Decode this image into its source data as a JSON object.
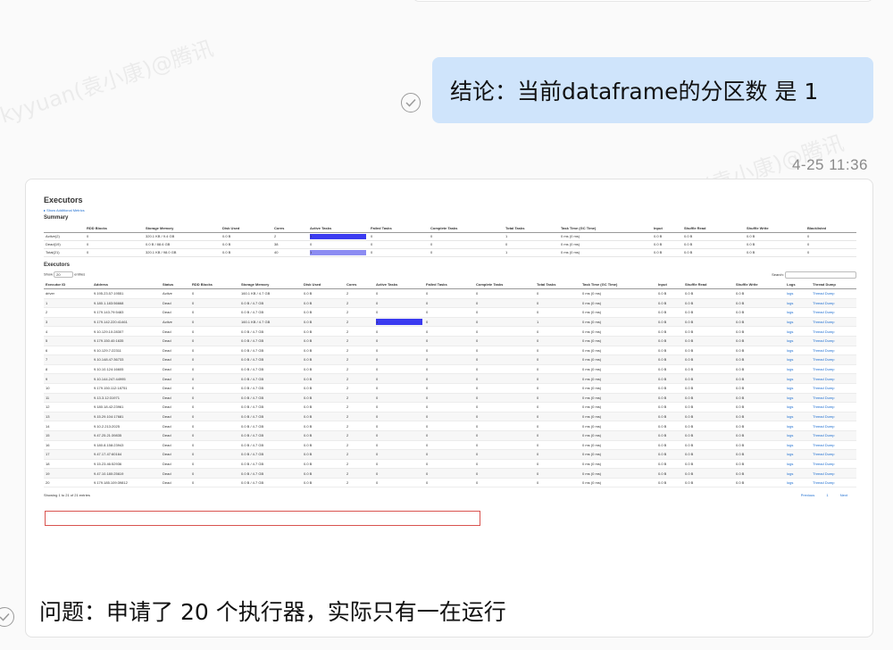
{
  "chat": {
    "watermark_text": "kyyuan(袁小康)@腾讯",
    "message_1": "结论：当前dataframe的分区数 是 1",
    "timestamp": "4-25 11:36",
    "message_2": "问题：申请了 20 个执行器，实际只有一在运行"
  },
  "screenshot": {
    "title": "Executors",
    "show_metrics": "▸ Show Additional Metrics",
    "summary": {
      "title": "Summary",
      "columns": [
        "",
        "RDD Blocks",
        "Storage Memory",
        "Disk Used",
        "Cores",
        "Active Tasks",
        "Failed Tasks",
        "Complete Tasks",
        "Total Tasks",
        "Task Time (GC Time)",
        "Input",
        "Shuffle Read",
        "Shuffle Write",
        "Blacklisted"
      ],
      "rows": [
        {
          "label": "Active(2)",
          "rdd": "0",
          "storage": "320.1 KB / 9.4 GB",
          "disk": "0.0 B",
          "cores": "2",
          "active": "1",
          "active_fill": 1.0,
          "failed": "0",
          "complete": "0",
          "total": "1",
          "time": "0 ms (0 ms)",
          "input": "0.0 B",
          "shuffle_read": "0.0 B",
          "shuffle_write": "0.0 B",
          "blacklisted": "0"
        },
        {
          "label": "Dead(19)",
          "rdd": "0",
          "storage": "0.0 B / 88.6 GB",
          "disk": "0.0 B",
          "cores": "38",
          "active": "0",
          "active_fill": 0.0,
          "failed": "0",
          "complete": "0",
          "total": "0",
          "time": "0 ms (0 ms)",
          "input": "0.0 B",
          "shuffle_read": "0.0 B",
          "shuffle_write": "0.0 B",
          "blacklisted": "0"
        },
        {
          "label": "Total(21)",
          "rdd": "0",
          "storage": "320.1 KB / 98.0 GB",
          "disk": "0.0 B",
          "cores": "40",
          "active": "1",
          "active_fill": 1.0,
          "failed": "0",
          "complete": "0",
          "total": "1",
          "time": "0 ms (0 ms)",
          "input": "0.0 B",
          "shuffle_read": "0.0 B",
          "shuffle_write": "0.0 B",
          "blacklisted": "0"
        }
      ],
      "active_color": "#3b3bf0",
      "total_color": "#8c8cf2"
    },
    "executors": {
      "title": "Executors",
      "show_label": "Show",
      "entries_value": "20",
      "entries_label": "entries",
      "search_label": "Search:",
      "columns": [
        "Executor ID",
        "Address",
        "Status",
        "RDD Blocks",
        "Storage Memory",
        "Disk Used",
        "Cores",
        "Active Tasks",
        "Failed Tasks",
        "Complete Tasks",
        "Total Tasks",
        "Task Time (GC Time)",
        "Input",
        "Shuffle Read",
        "Shuffle Write",
        "Logs",
        "Thread Dump"
      ],
      "rows": [
        {
          "id": "driver",
          "address": "9.195.23.57:19551",
          "status": "Active",
          "storage": "160.1 KB / 4.7 GB",
          "active": "0",
          "active_fill": 0.0,
          "total": "0"
        },
        {
          "id": "1",
          "address": "9.180.1.183:56668",
          "status": "Dead",
          "storage": "0.0 B / 4.7 GB",
          "active": "0",
          "active_fill": 0.0,
          "total": "0"
        },
        {
          "id": "2",
          "address": "9.179.143.79:5483",
          "status": "Dead",
          "storage": "0.0 B / 4.7 GB",
          "active": "0",
          "active_fill": 0.0,
          "total": "0"
        },
        {
          "id": "3",
          "address": "9.179.142.220:41461",
          "status": "Active",
          "storage": "160.1 KB / 4.7 GB",
          "active": "1",
          "active_fill": 1.0,
          "total": "1"
        },
        {
          "id": "4",
          "address": "9.10.129.10:28307",
          "status": "Dead",
          "storage": "0.0 B / 4.7 GB",
          "active": "0",
          "active_fill": 0.0,
          "total": "0"
        },
        {
          "id": "5",
          "address": "9.179.150.40:1635",
          "status": "Dead",
          "storage": "0.0 B / 4.7 GB",
          "active": "0",
          "active_fill": 0.0,
          "total": "0"
        },
        {
          "id": "6",
          "address": "9.10.129.7:22311",
          "status": "Dead",
          "storage": "0.0 B / 4.7 GB",
          "active": "0",
          "active_fill": 0.0,
          "total": "0"
        },
        {
          "id": "7",
          "address": "9.10.148.47:36733",
          "status": "Dead",
          "storage": "0.0 B / 4.7 GB",
          "active": "0",
          "active_fill": 0.0,
          "total": "0"
        },
        {
          "id": "8",
          "address": "9.10.10.124:16605",
          "status": "Dead",
          "storage": "0.0 B / 4.7 GB",
          "active": "0",
          "active_fill": 0.0,
          "total": "0"
        },
        {
          "id": "9",
          "address": "9.10.144.247:44995",
          "status": "Dead",
          "storage": "0.0 B / 4.7 GB",
          "active": "0",
          "active_fill": 0.0,
          "total": "0"
        },
        {
          "id": "10",
          "address": "9.179.150.112:18751",
          "status": "Dead",
          "storage": "0.0 B / 4.7 GB",
          "active": "0",
          "active_fill": 0.0,
          "total": "0"
        },
        {
          "id": "11",
          "address": "9.13.3.12:31971",
          "status": "Dead",
          "storage": "0.0 B / 4.7 GB",
          "active": "0",
          "active_fill": 0.0,
          "total": "0"
        },
        {
          "id": "12",
          "address": "9.180.18.42:23961",
          "status": "Dead",
          "storage": "0.0 B / 4.7 GB",
          "active": "0",
          "active_fill": 0.0,
          "total": "0"
        },
        {
          "id": "13",
          "address": "9.15.29.104:17681",
          "status": "Dead",
          "storage": "0.0 B / 4.7 GB",
          "active": "0",
          "active_fill": 0.0,
          "total": "0"
        },
        {
          "id": "14",
          "address": "9.10.2.213:2025",
          "status": "Dead",
          "storage": "0.0 B / 4.7 GB",
          "active": "0",
          "active_fill": 0.0,
          "total": "0"
        },
        {
          "id": "15",
          "address": "9.47.25.21:39835",
          "status": "Dead",
          "storage": "0.0 B / 4.7 GB",
          "active": "0",
          "active_fill": 0.0,
          "total": "0"
        },
        {
          "id": "16",
          "address": "9.180.8.158:23943",
          "status": "Dead",
          "storage": "0.0 B / 4.7 GB",
          "active": "0",
          "active_fill": 0.0,
          "total": "0"
        },
        {
          "id": "17",
          "address": "9.47.17.47:60164",
          "status": "Dead",
          "storage": "0.0 B / 4.7 GB",
          "active": "0",
          "active_fill": 0.0,
          "total": "0"
        },
        {
          "id": "18",
          "address": "9.15.23.46:52936",
          "status": "Dead",
          "storage": "0.0 B / 4.7 GB",
          "active": "0",
          "active_fill": 0.0,
          "total": "0"
        },
        {
          "id": "19",
          "address": "9.47.10.180:25619",
          "status": "Dead",
          "storage": "0.0 B / 4.7 GB",
          "active": "0",
          "active_fill": 0.0,
          "total": "0"
        },
        {
          "id": "20",
          "address": "9.179.185.109:39812",
          "status": "Dead",
          "storage": "0.0 B / 4.7 GB",
          "active": "0",
          "active_fill": 0.0,
          "total": "0"
        }
      ],
      "cell_defaults": {
        "rdd": "0",
        "disk": "0.0 B",
        "cores": "2",
        "failed": "0",
        "complete": "0",
        "time": "0 ms (0 ms)",
        "input": "0.0 B",
        "shuffle_read": "0.0 B",
        "shuffle_write": "0.0 B",
        "logs": "logs",
        "dump": "Thread Dump"
      },
      "showing": "Showing 1 to 21 of 21 entries",
      "previous": "Previous",
      "page": "1",
      "next": "Next"
    },
    "highlight_color": "#d9534f"
  }
}
